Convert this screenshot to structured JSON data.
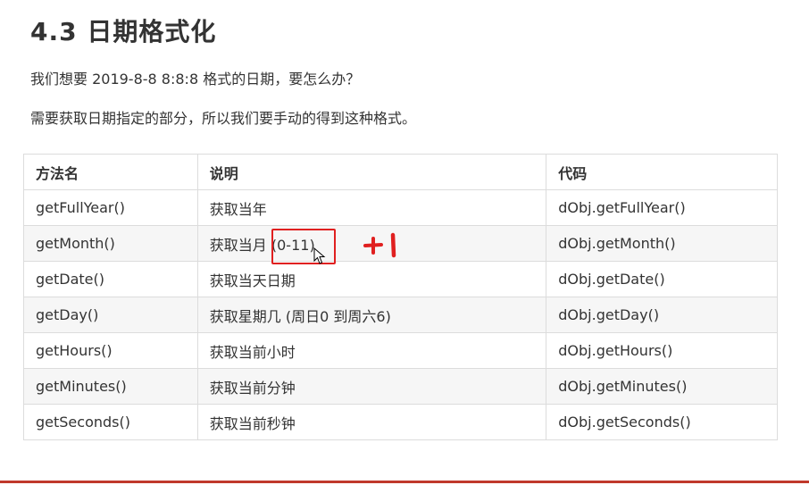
{
  "heading": "4.3 日期格式化",
  "paragraphs": [
    "我们想要 2019-8-8  8:8:8 格式的日期，要怎么办？",
    "需要获取日期指定的部分，所以我们要手动的得到这种格式。"
  ],
  "table": {
    "headers": [
      "方法名",
      "说明",
      "代码"
    ],
    "rows": [
      [
        "getFullYear()",
        "获取当年",
        "dObj.getFullYear()"
      ],
      [
        "getMonth()",
        "获取当月  (0-11)",
        "dObj.getMonth()"
      ],
      [
        "getDate()",
        "获取当天日期",
        "dObj.getDate()"
      ],
      [
        "getDay()",
        "获取星期几  (周日0 到周六6)",
        "dObj.getDay()"
      ],
      [
        "getHours()",
        "获取当前小时",
        "dObj.getHours()"
      ],
      [
        "getMinutes()",
        "获取当前分钟",
        "dObj.getMinutes()"
      ],
      [
        "getSeconds()",
        "获取当前秒钟",
        "dObj.getSeconds()"
      ]
    ]
  },
  "annotation": {
    "handwritten_note": "+1",
    "highlight_color": "#e02020"
  },
  "colors": {
    "text": "#333333",
    "border": "#dcdcdc",
    "stripe": "#f6f6f6",
    "accent_rule": "#c0392b"
  }
}
